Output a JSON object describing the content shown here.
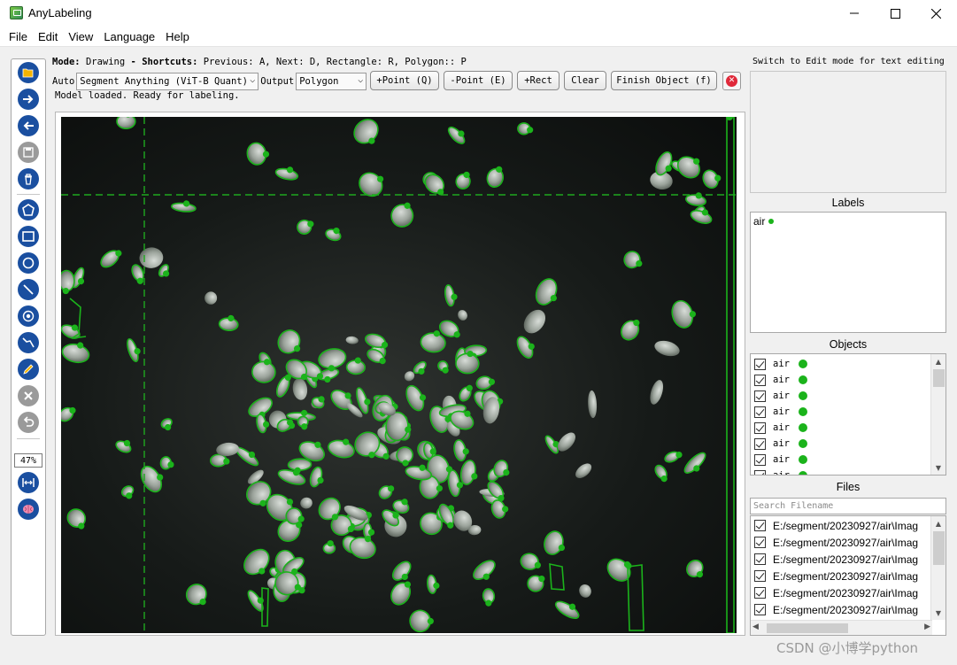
{
  "window": {
    "title": "AnyLabeling"
  },
  "menu": [
    "File",
    "Edit",
    "View",
    "Language",
    "Help"
  ],
  "toolbar": {
    "tools": [
      {
        "name": "open-dir-icon"
      },
      {
        "name": "next-image-icon"
      },
      {
        "name": "prev-image-icon"
      },
      {
        "name": "save-icon"
      },
      {
        "name": "delete-file-icon"
      },
      {
        "name": "polygon-icon"
      },
      {
        "name": "rectangle-icon"
      },
      {
        "name": "circle-icon"
      },
      {
        "name": "line-icon"
      },
      {
        "name": "point-icon"
      },
      {
        "name": "linestrip-icon"
      },
      {
        "name": "edit-pencil-icon"
      },
      {
        "name": "delete-shape-icon"
      },
      {
        "name": "undo-icon"
      },
      {
        "name": "fit-width-icon"
      },
      {
        "name": "brain-ai-icon"
      }
    ],
    "zoom": "47%"
  },
  "header": {
    "mode_label": "Mode:",
    "mode_value": "Drawing",
    "dash": "-",
    "shortcuts_label": "Shortcuts:",
    "shortcuts_text": "Previous: A, Next: D, Rectangle: R, Polygon:: P"
  },
  "controls": {
    "auto_label": "Auto",
    "model": "Segment Anything (ViT-B Quant)",
    "output_label": "Output",
    "output_value": "Polygon",
    "btn_add_point": "+Point (Q)",
    "btn_remove_point": "-Point (E)",
    "btn_rect": "+Rect",
    "btn_clear": "Clear",
    "btn_finish": "Finish Object (f)",
    "close_icon": "close-red-icon"
  },
  "status": "Model loaded. Ready for labeling.",
  "right": {
    "hint": "Switch to Edit mode for text editing",
    "labels_title": "Labels",
    "labels": [
      "air"
    ],
    "objects_title": "Objects",
    "objects": [
      "air",
      "air",
      "air",
      "air",
      "air",
      "air",
      "air",
      "air"
    ],
    "files_title": "Files",
    "search_placeholder": "Search Filename",
    "files": [
      "E:/segment/20230927/air\\Imag",
      "E:/segment/20230927/air\\Imag",
      "E:/segment/20230927/air\\Imag",
      "E:/segment/20230927/air\\Imag",
      "E:/segment/20230927/air\\Imag",
      "E:/segment/20230927/air\\Imag"
    ]
  },
  "watermark": "CSDN @小博学python",
  "colors": {
    "accent": "#1bb31b",
    "tool_blue": "#1a4fa0",
    "close_red": "#e0293a"
  }
}
